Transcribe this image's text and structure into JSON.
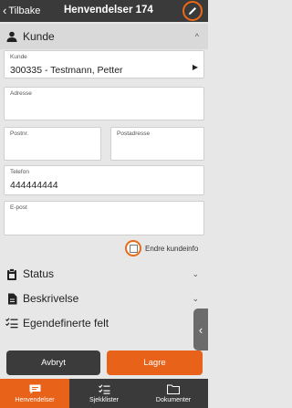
{
  "header": {
    "back_label": "Tilbake",
    "title": "Henvendelser 174"
  },
  "kunde_section": {
    "title": "Kunde",
    "fields": {
      "kunde": {
        "label": "Kunde",
        "value": "300335 - Testmann, Petter"
      },
      "adresse": {
        "label": "Adresse",
        "value": ""
      },
      "postnr": {
        "label": "Postnr.",
        "value": ""
      },
      "postadresse": {
        "label": "Postadresse",
        "value": ""
      },
      "telefon": {
        "label": "Telefon",
        "value": "444444444"
      },
      "epost": {
        "label": "E-post",
        "value": ""
      }
    },
    "checkbox": {
      "label": "Endre kundeinfo",
      "checked": false
    }
  },
  "sections": [
    {
      "title": "Status"
    },
    {
      "title": "Beskrivelse"
    },
    {
      "title": "Egendefinerte felt"
    }
  ],
  "actions": {
    "cancel": "Avbryt",
    "save": "Lagre"
  },
  "bottom_nav": [
    {
      "label": "Henvendelser",
      "active": true
    },
    {
      "label": "Sjekklister",
      "active": false
    },
    {
      "label": "Dokumenter",
      "active": false
    }
  ],
  "colors": {
    "accent": "#e8621a",
    "dark": "#3a3a3a",
    "background": "#e7e7e7"
  }
}
